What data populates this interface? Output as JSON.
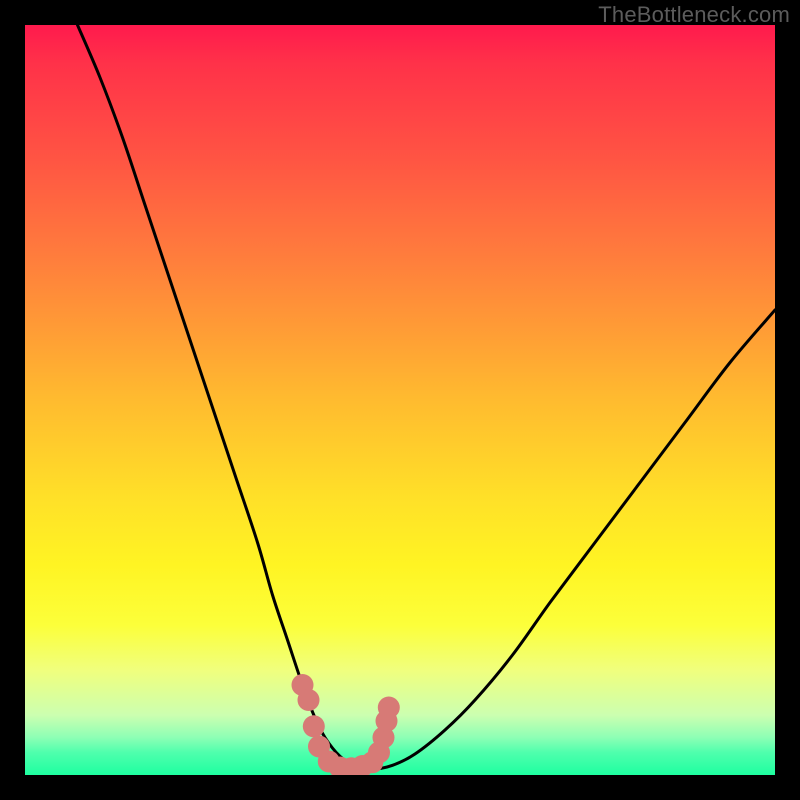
{
  "watermark": "TheBottleneck.com",
  "chart_data": {
    "type": "line",
    "title": "",
    "xlabel": "",
    "ylabel": "",
    "xlim": [
      0,
      100
    ],
    "ylim": [
      0,
      100
    ],
    "grid": false,
    "series": [
      {
        "name": "bottleneck-curve",
        "color": "#000000",
        "x": [
          7,
          10,
          13,
          16,
          19,
          22,
          25,
          28,
          31,
          33,
          35,
          37,
          38.5,
          40,
          42,
          44,
          46.5,
          49,
          52,
          56,
          60,
          65,
          70,
          76,
          82,
          88,
          94,
          100
        ],
        "y": [
          100,
          93,
          85,
          76,
          67,
          58,
          49,
          40,
          31,
          24,
          18,
          12,
          8,
          5,
          2.5,
          1.3,
          0.8,
          1.3,
          2.8,
          6,
          10,
          16,
          23,
          31,
          39,
          47,
          55,
          62
        ]
      },
      {
        "name": "highlight-dots",
        "color": "#d77a76",
        "points": [
          {
            "x": 37.0,
            "y": 12.0
          },
          {
            "x": 37.8,
            "y": 10.0
          },
          {
            "x": 38.5,
            "y": 6.5
          },
          {
            "x": 39.2,
            "y": 3.8
          },
          {
            "x": 40.5,
            "y": 1.8
          },
          {
            "x": 42.0,
            "y": 1.0
          },
          {
            "x": 43.5,
            "y": 0.9
          },
          {
            "x": 45.0,
            "y": 1.2
          },
          {
            "x": 46.3,
            "y": 1.7
          },
          {
            "x": 47.2,
            "y": 3.0
          },
          {
            "x": 47.8,
            "y": 5.0
          },
          {
            "x": 48.2,
            "y": 7.2
          },
          {
            "x": 48.5,
            "y": 9.0
          }
        ]
      }
    ],
    "gradient_stops": [
      {
        "pos": 0,
        "color": "#ff1a4d"
      },
      {
        "pos": 50,
        "color": "#ffbb2f"
      },
      {
        "pos": 80,
        "color": "#fcff3a"
      },
      {
        "pos": 100,
        "color": "#1effa0"
      }
    ]
  }
}
